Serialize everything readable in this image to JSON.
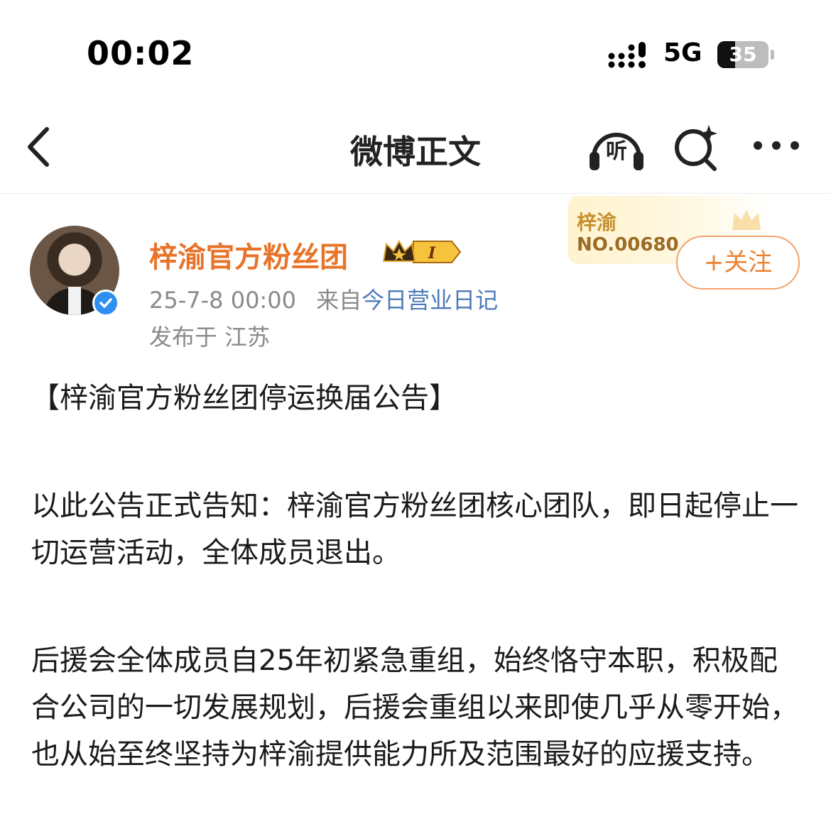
{
  "status_bar": {
    "time": "00:02",
    "network": "5G",
    "battery_level": "35",
    "battery_fraction": 0.35
  },
  "nav": {
    "title": "微博正文",
    "listen_label": "听",
    "icons": [
      "back-arrow-icon",
      "headphones-icon",
      "search-sparkle-icon",
      "more-icon"
    ]
  },
  "post": {
    "author": "梓渝官方粉丝团",
    "level_badge": "I",
    "timestamp": "25-7-8 00:00",
    "source_prefix": "来自",
    "source": "今日营业日记",
    "location": "发布于 江苏",
    "fan_card": {
      "name": "梓渝",
      "number": "NO.00680"
    },
    "follow_label": "+关注",
    "colors": {
      "author": "#e8742a",
      "source_link": "#4d7ab8",
      "follow": "#ee8130",
      "verified": "#2f8ff0"
    },
    "title": "【梓渝官方粉丝团停运换届公告】",
    "paragraphs": [
      "以此公告正式告知：梓渝官方粉丝团核心团队，即日起停止一切运营活动，全体成员退出。",
      "后援会全体成员自25年初紧急重组，始终恪守本职，积极配合公司的一切发展规划，后援会重组以来即使几乎从零开始，也从始至终坚持为梓渝提供能力所及范围最好的应援支持。"
    ]
  }
}
